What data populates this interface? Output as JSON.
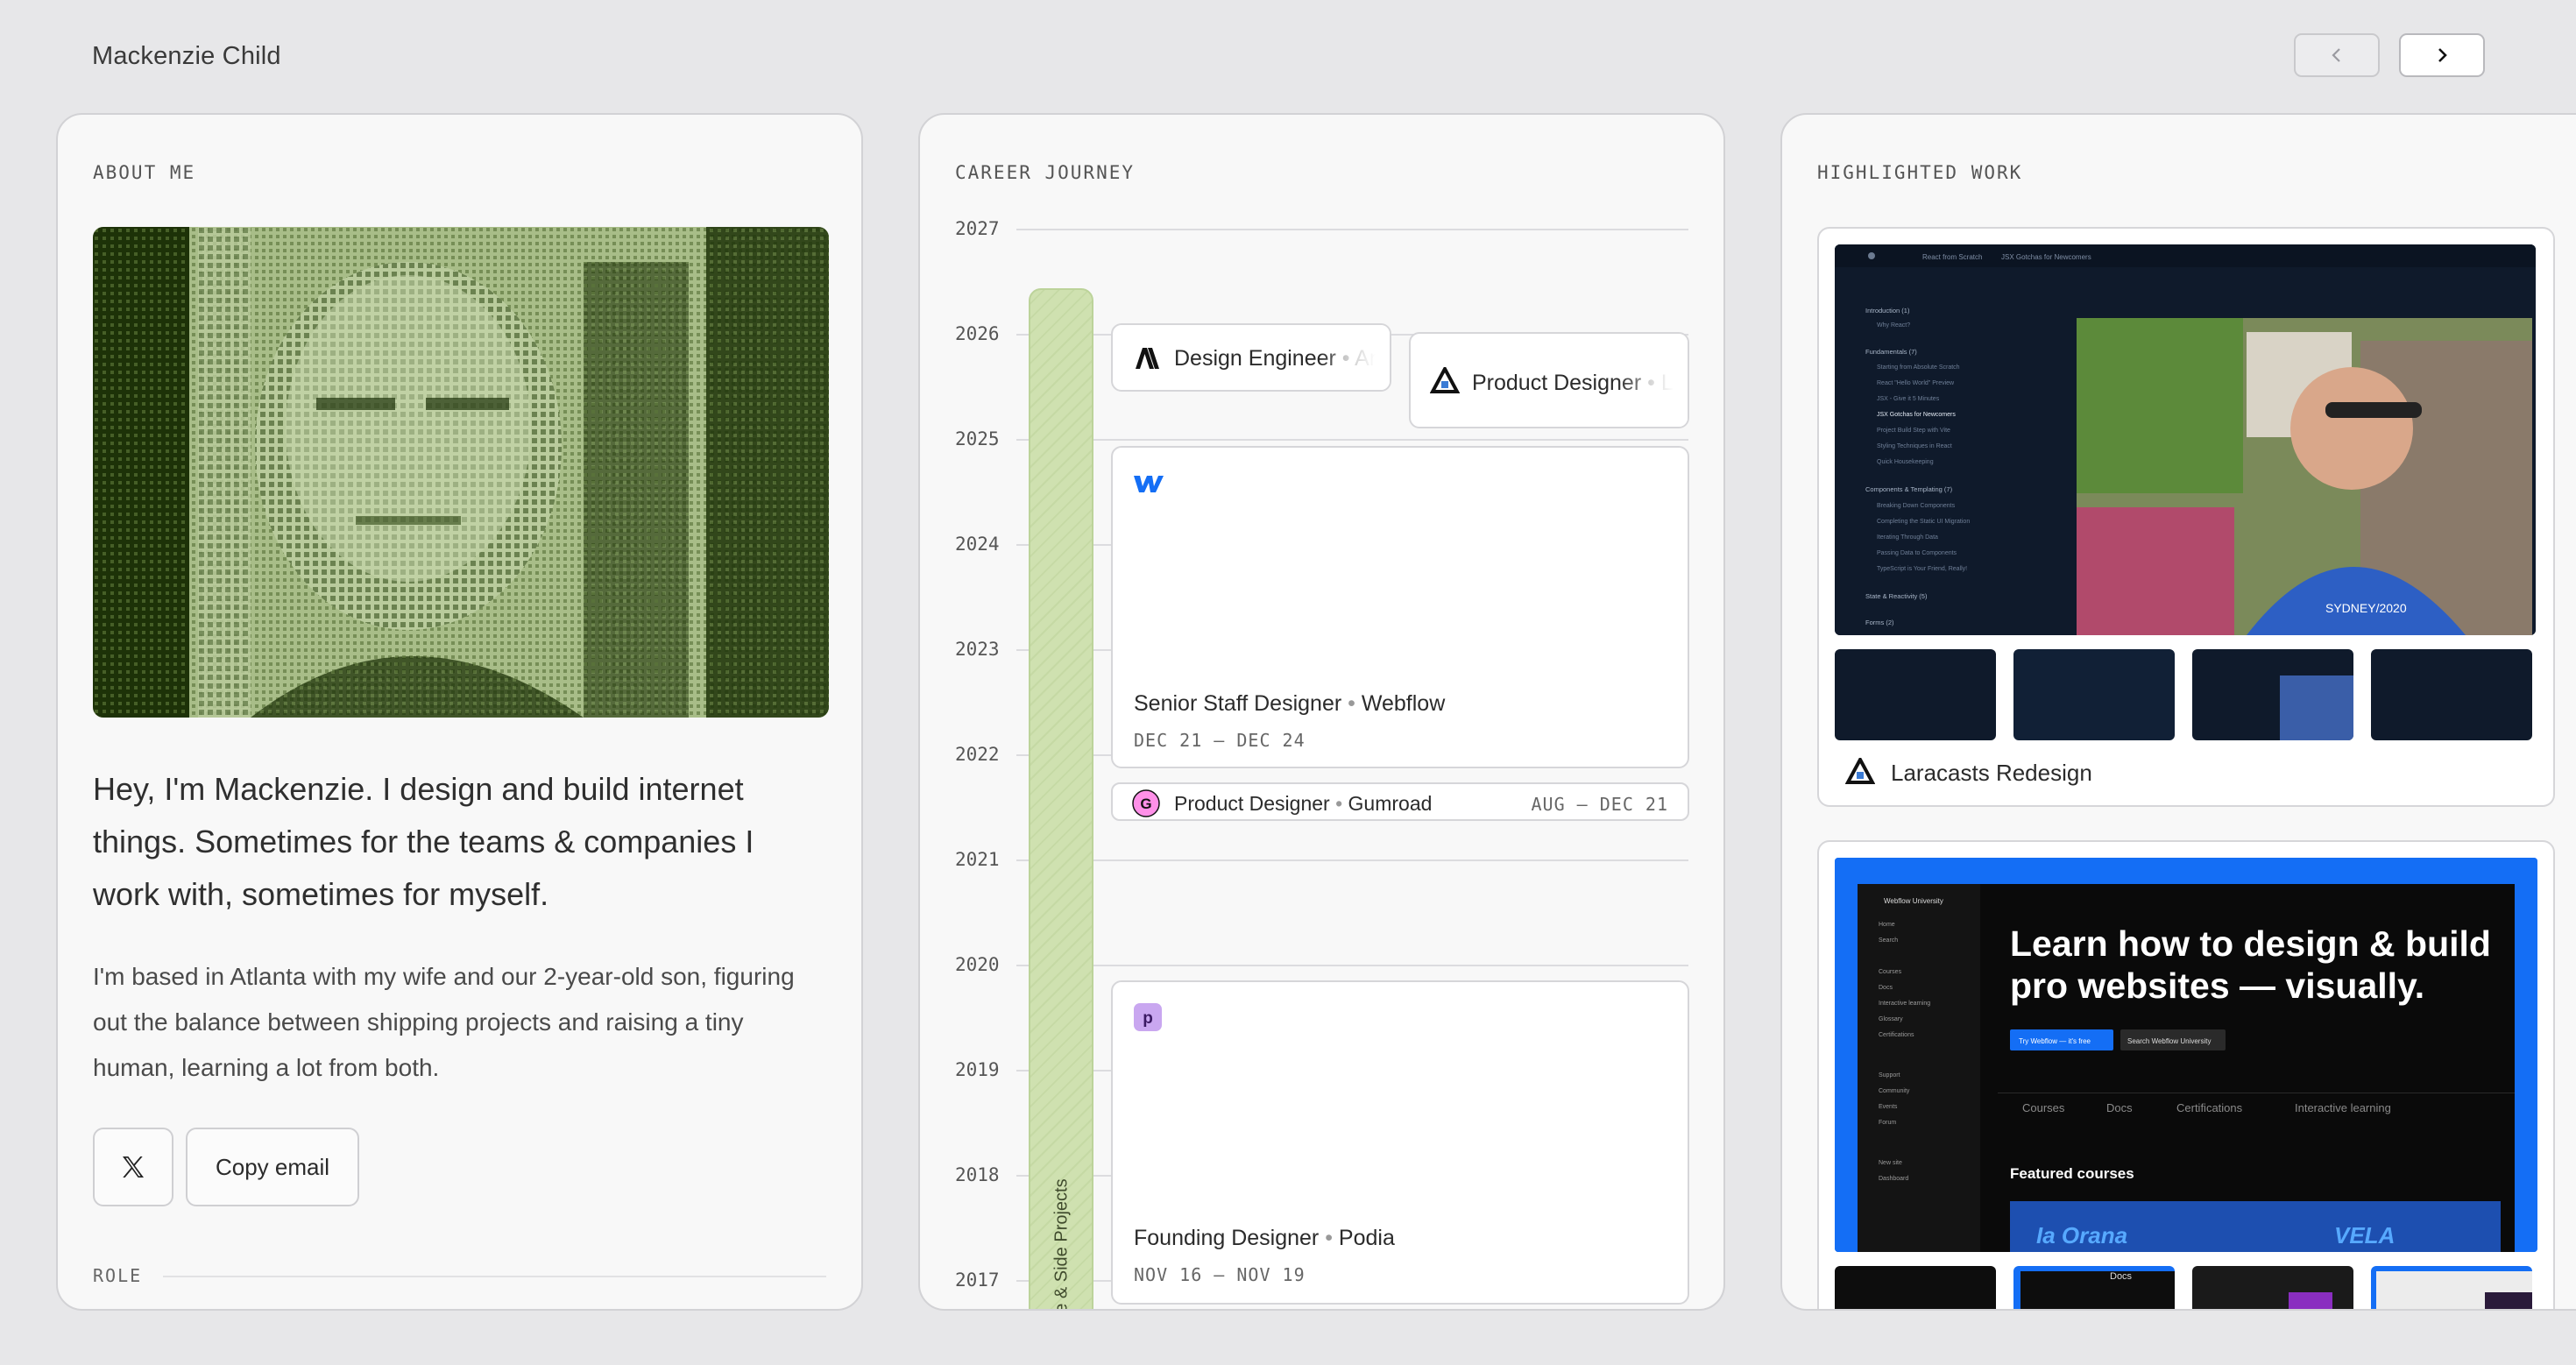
{
  "header": {
    "site_name": "Mackenzie Child",
    "prev_icon": "chevron-left-icon",
    "next_icon": "chevron-right-icon"
  },
  "about": {
    "title": "ABOUT ME",
    "intro": "Hey, I'm Mackenzie. I design and build internet things. Sometimes for the teams & companies I work with, sometimes for myself.",
    "bio": "I'm based in Atlanta with my wife and our 2-year-old son, figuring out the balance between shipping projects and raising a tiny human, learning a lot from both.",
    "x_icon": "x-logo-icon",
    "copy_email": "Copy email",
    "role_label": "ROLE"
  },
  "career": {
    "title": "CAREER JOURNEY",
    "years": [
      "2027",
      "2026",
      "2025",
      "2024",
      "2023",
      "2022",
      "2021",
      "2020",
      "2019",
      "2018",
      "2017"
    ],
    "freelance_label": "Freelance & Side Projects",
    "jobs": [
      {
        "role": "Design Engineer",
        "company": "Anthropic",
        "icon": "anthropic-logo-icon"
      },
      {
        "role": "Product Designer",
        "company": "Laracasts",
        "icon": "laracasts-logo-icon"
      },
      {
        "role": "Senior Staff Designer",
        "company": "Webflow",
        "dates": "DEC 21 — DEC 24",
        "icon": "webflow-logo-icon"
      },
      {
        "role": "Product Designer",
        "company": "Gumroad",
        "dates": "AUG — DEC 21",
        "icon": "gumroad-logo-icon"
      },
      {
        "role": "Founding Designer",
        "company": "Podia",
        "dates": "NOV 16 — NOV 19",
        "icon": "podia-logo-icon"
      }
    ],
    "separator": "•"
  },
  "work": {
    "title": "HIGHLIGHTED WORK",
    "items": [
      {
        "label": "Laracasts Redesign",
        "icon": "laracasts-logo-icon"
      },
      {
        "label": "",
        "icon": "webflow-logo-icon"
      }
    ],
    "laracasts_sidebar": {
      "breadcrumb": [
        "React from Scratch",
        "JSX Gotchas for Newcomers"
      ],
      "sections": [
        {
          "heading": "Introduction (1)",
          "lessons": [
            "Why React?"
          ]
        },
        {
          "heading": "Fundamentals (7)",
          "lessons": [
            "Starting from Absolute Scratch",
            "React \"Hello World\" Preview",
            "JSX - Give it 5 Minutes",
            "JSX Gotchas for Newcomers",
            "Project Build Step with Vite",
            "Styling Techniques in React",
            "Quick Housekeeping"
          ]
        },
        {
          "heading": "Components & Templating (7)",
          "lessons": [
            "Breaking Down Components",
            "Completing the Static UI Migration",
            "Iterating Through Data",
            "Passing Data to Components",
            "TypeScript is Your Friend, Really!"
          ]
        },
        {
          "heading": "State & Reactivity (5)",
          "lessons": []
        },
        {
          "heading": "Forms (2)",
          "lessons": []
        }
      ],
      "shirt_text": "SYDNEY/2020"
    },
    "webflow_shot": {
      "brand": "Webflow University",
      "nav": [
        "Home",
        "Search",
        "Courses",
        "Docs",
        "Interactive learning",
        "Glossary",
        "Certifications",
        "Support",
        "Community",
        "Events",
        "Forum",
        "New site",
        "Dashboard"
      ],
      "headline_1": "Learn how to design & build",
      "headline_2": "pro websites — visually.",
      "cta_primary": "Try Webflow — it's free",
      "cta_secondary": "Search Webflow University",
      "tabs": [
        "Courses",
        "Docs",
        "Certifications",
        "Interactive learning"
      ],
      "featured": "Featured courses",
      "course_1": "Ia Orana",
      "course_2": "VELA",
      "thumb_docs": "Docs"
    }
  },
  "colors": {
    "background": "#e7e7e9",
    "card": "#f8f8f8",
    "freelance_green": "#cfe1b0",
    "portrait_dark": "#1d3208",
    "portrait_light": "#b7c99a",
    "webflow_blue": "#146ef5",
    "gumroad_pink": "#ff90e8",
    "podia_purple": "#c9a7f0"
  }
}
